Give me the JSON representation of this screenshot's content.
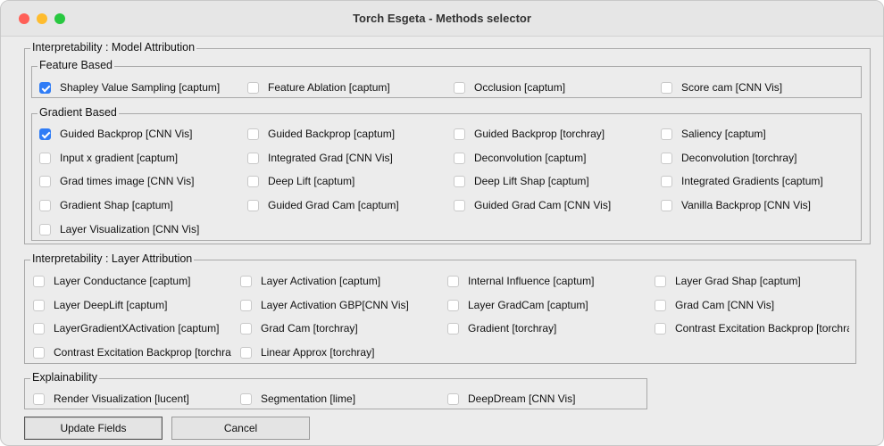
{
  "window": {
    "title": "Torch Esgeta - Methods selector"
  },
  "model_attribution": {
    "legend": "Interpretability : Model Attribution",
    "feature_based": {
      "legend": "Feature Based",
      "items": [
        {
          "label": "Shapley Value Sampling [captum]",
          "checked": true
        },
        {
          "label": "Feature Ablation [captum]",
          "checked": false
        },
        {
          "label": "Occlusion [captum]",
          "checked": false
        },
        {
          "label": "Score cam [CNN Vis]",
          "checked": false
        }
      ]
    },
    "gradient_based": {
      "legend": "Gradient Based",
      "items": [
        {
          "label": "Guided Backprop [CNN Vis]",
          "checked": true
        },
        {
          "label": "Guided Backprop [captum]",
          "checked": false
        },
        {
          "label": "Guided Backprop  [torchray]",
          "checked": false
        },
        {
          "label": "Saliency [captum]",
          "checked": false
        },
        {
          "label": "Input x gradient [captum]",
          "checked": false
        },
        {
          "label": "Integrated Grad [CNN Vis]",
          "checked": false
        },
        {
          "label": "Deconvolution [captum]",
          "checked": false
        },
        {
          "label": "Deconvolution [torchray]",
          "checked": false
        },
        {
          "label": "Grad times image [CNN Vis]",
          "checked": false
        },
        {
          "label": "Deep Lift [captum]",
          "checked": false
        },
        {
          "label": "Deep Lift Shap [captum]",
          "checked": false
        },
        {
          "label": "Integrated Gradients [captum]",
          "checked": false
        },
        {
          "label": "Gradient Shap [captum]",
          "checked": false
        },
        {
          "label": "Guided Grad Cam [captum]",
          "checked": false
        },
        {
          "label": "Guided Grad Cam [CNN Vis]",
          "checked": false
        },
        {
          "label": "Vanilla Backprop [CNN Vis]",
          "checked": false
        },
        {
          "label": "Layer Visualization [CNN Vis]",
          "checked": false
        }
      ]
    }
  },
  "layer_attribution": {
    "legend": "Interpretability : Layer Attribution",
    "items": [
      {
        "label": "Layer Conductance [captum]",
        "checked": false
      },
      {
        "label": "Layer Activation [captum]",
        "checked": false
      },
      {
        "label": "Internal Influence [captum]",
        "checked": false
      },
      {
        "label": "Layer Grad Shap [captum]",
        "checked": false
      },
      {
        "label": "Layer DeepLift [captum]",
        "checked": false
      },
      {
        "label": "Layer Activation GBP[CNN Vis]",
        "checked": false
      },
      {
        "label": "Layer GradCam [captum]",
        "checked": false
      },
      {
        "label": "Grad Cam [CNN Vis]",
        "checked": false
      },
      {
        "label": "LayerGradientXActivation [captum]",
        "checked": false
      },
      {
        "label": "Grad Cam [torchray]",
        "checked": false
      },
      {
        "label": "Gradient [torchray]",
        "checked": false
      },
      {
        "label": "Contrast Excitation Backprop [torchray",
        "checked": false
      },
      {
        "label": "Contrast Excitation Backprop [torchray",
        "checked": false
      },
      {
        "label": "Linear Approx [torchray]",
        "checked": false
      }
    ]
  },
  "explainability": {
    "legend": "Explainability",
    "items": [
      {
        "label": "Render Visualization [lucent]",
        "checked": false
      },
      {
        "label": "Segmentation [lime]",
        "checked": false
      },
      {
        "label": "DeepDream [CNN Vis]",
        "checked": false
      }
    ]
  },
  "buttons": {
    "update": "Update Fields",
    "cancel": "Cancel"
  }
}
